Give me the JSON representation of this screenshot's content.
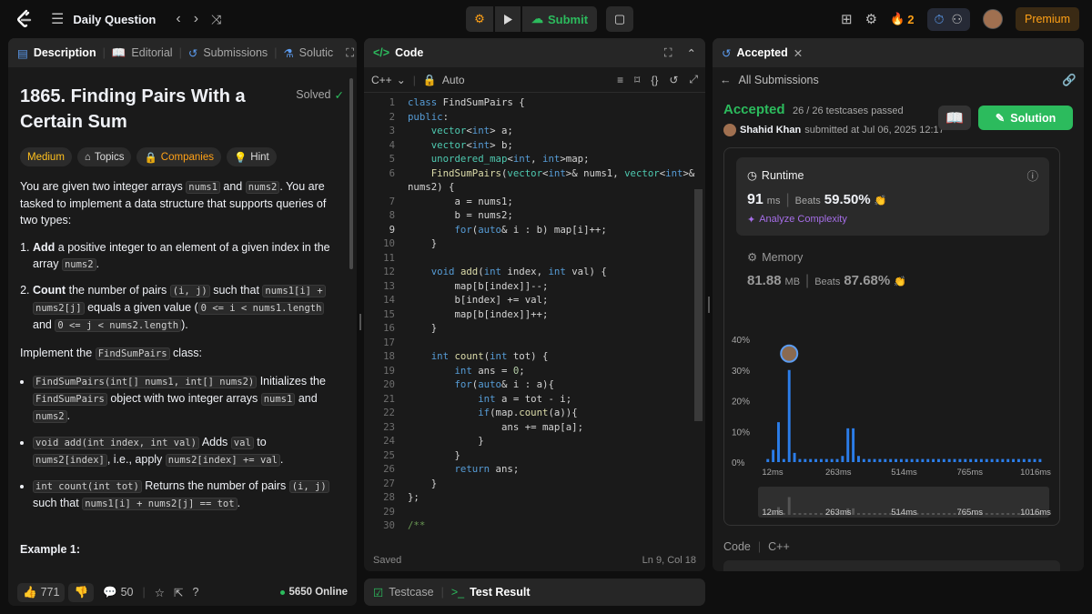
{
  "topbar": {
    "title": "Daily Question",
    "submit": "Submit",
    "streak": "2",
    "premium": "Premium"
  },
  "desc_tabs": {
    "description": "Description",
    "editorial": "Editorial",
    "submissions": "Submissions",
    "solutions": "Solutic"
  },
  "problem": {
    "title": "1865. Finding Pairs With a Certain Sum",
    "status": "Solved",
    "difficulty": "Medium",
    "tags": [
      "Topics",
      "Companies",
      "Hint"
    ],
    "intro": "You are given two integer arrays",
    "intro_a": "nums1",
    "intro_and": "and",
    "intro_b": "nums2",
    "intro_rest": ". You are tasked to implement a data structure that supports queries of two types:",
    "li1_b": "Add",
    "li1_t": "a positive integer to an element of a given index in the array",
    "li1_c": "nums2",
    "li1_end": ".",
    "li2_b": "Count",
    "li2_t1": "the number of pairs",
    "li2_c1": "(i, j)",
    "li2_t2": "such that",
    "li2_c2": "nums1[i] +",
    "li2_c3": "nums2[j]",
    "li2_t3": "equals a given value (",
    "li2_c4": "0 <= i < nums1.length",
    "li2_t4": "and",
    "li2_c5": "0 <= j < nums2.length",
    "li2_t5": ").",
    "impl_t": "Implement the",
    "impl_c": "FindSumPairs",
    "impl_e": "class:",
    "b1_c": "FindSumPairs(int[] nums1, int[] nums2)",
    "b1_t": "Initializes the",
    "b1_c2": "FindSumPairs",
    "b1_t2": "object with two integer arrays",
    "b1_c3": "nums1",
    "b1_t3": "and",
    "b1_c4": "nums2",
    "b1_t4": ".",
    "b2_c": "void add(int index, int val)",
    "b2_t": "Adds",
    "b2_c2": "val",
    "b2_t2": "to",
    "b2_c3": "nums2[index]",
    "b2_t3": ", i.e., apply",
    "b2_c4": "nums2[index] += val",
    "b2_t4": ".",
    "b3_c": "int count(int tot)",
    "b3_t": "Returns the number of pairs",
    "b3_c2": "(i, j)",
    "b3_t2": "such that",
    "b3_c3": "nums1[i] + nums2[j] == tot",
    "b3_t3": ".",
    "example": "Example 1:"
  },
  "desc_footer": {
    "likes": "771",
    "comments": "50",
    "online": "5650 Online"
  },
  "code_panel": {
    "title": "Code",
    "lang": "C++",
    "auto": "Auto",
    "status": "Saved",
    "cursor": "Ln 9, Col 18",
    "lines": [
      "class FindSumPairs {",
      "public:",
      "    vector<int> a;",
      "    vector<int> b;",
      "    unordered_map<int, int>map;",
      "    FindSumPairs(vector<int>& nums1, vector<int>&",
      "nums2) {",
      "        a = nums1;",
      "        b = nums2;",
      "        for(auto& i : b) map[i]++;",
      "    }",
      "",
      "    void add(int index, int val) {",
      "        map[b[index]]--;",
      "        b[index] += val;",
      "        map[b[index]]++;",
      "    }",
      "",
      "    int count(int tot) {",
      "        int ans = 0;",
      "        for(auto& i : a){",
      "            int a = tot - i;",
      "            if(map.count(a)){",
      "                ans += map[a];",
      "            }",
      "        }",
      "        return ans;",
      "    }",
      "};",
      "",
      "/**"
    ],
    "numbers": [
      "1",
      "2",
      "3",
      "4",
      "5",
      "6",
      "",
      "7",
      "8",
      "9",
      "10",
      "11",
      "12",
      "13",
      "14",
      "15",
      "16",
      "17",
      "18",
      "19",
      "20",
      "21",
      "22",
      "23",
      "24",
      "25",
      "26",
      "27",
      "28",
      "29",
      "30"
    ]
  },
  "bottom_tabs": {
    "testcase": "Testcase",
    "result": "Test Result"
  },
  "result": {
    "tab": "Accepted",
    "back": "All Submissions",
    "status": "Accepted",
    "cases": "26 / 26 testcases passed",
    "user": "Shahid Khan",
    "submitted": "submitted at Jul 06, 2025 12:17",
    "solution_btn": "Solution",
    "runtime_label": "Runtime",
    "runtime_val": "91",
    "runtime_unit": "ms",
    "beats": "Beats",
    "runtime_beats": "59.50%",
    "analyze": "Analyze Complexity",
    "memory_label": "Memory",
    "memory_val": "81.88",
    "memory_unit": "MB",
    "memory_beats": "87.68%",
    "code_label": "Code",
    "code_lang": "C++"
  },
  "chart_data": {
    "type": "bar",
    "ylabels": [
      "40%",
      "30%",
      "20%",
      "10%",
      "0%"
    ],
    "xlabels": [
      "12ms",
      "263ms",
      "514ms",
      "765ms",
      "1016ms"
    ],
    "ylim": [
      0,
      40
    ],
    "values": [
      1,
      4,
      13,
      1,
      30,
      3,
      1,
      1,
      1,
      1,
      1,
      1,
      1,
      1,
      2,
      11,
      11,
      2,
      1,
      1,
      1,
      1,
      1,
      1,
      1,
      1,
      1,
      1,
      1,
      1,
      1,
      1,
      1,
      1,
      1,
      1,
      1,
      1,
      1,
      1,
      1,
      1,
      1,
      1,
      1,
      1,
      1,
      1,
      1,
      1,
      1,
      1
    ],
    "highlight_index": 4,
    "accent": "#2b7de9"
  },
  "colors": {
    "accent_green": "#2cbb5d",
    "medium": "#ffc01e",
    "orange": "#ffa116"
  }
}
